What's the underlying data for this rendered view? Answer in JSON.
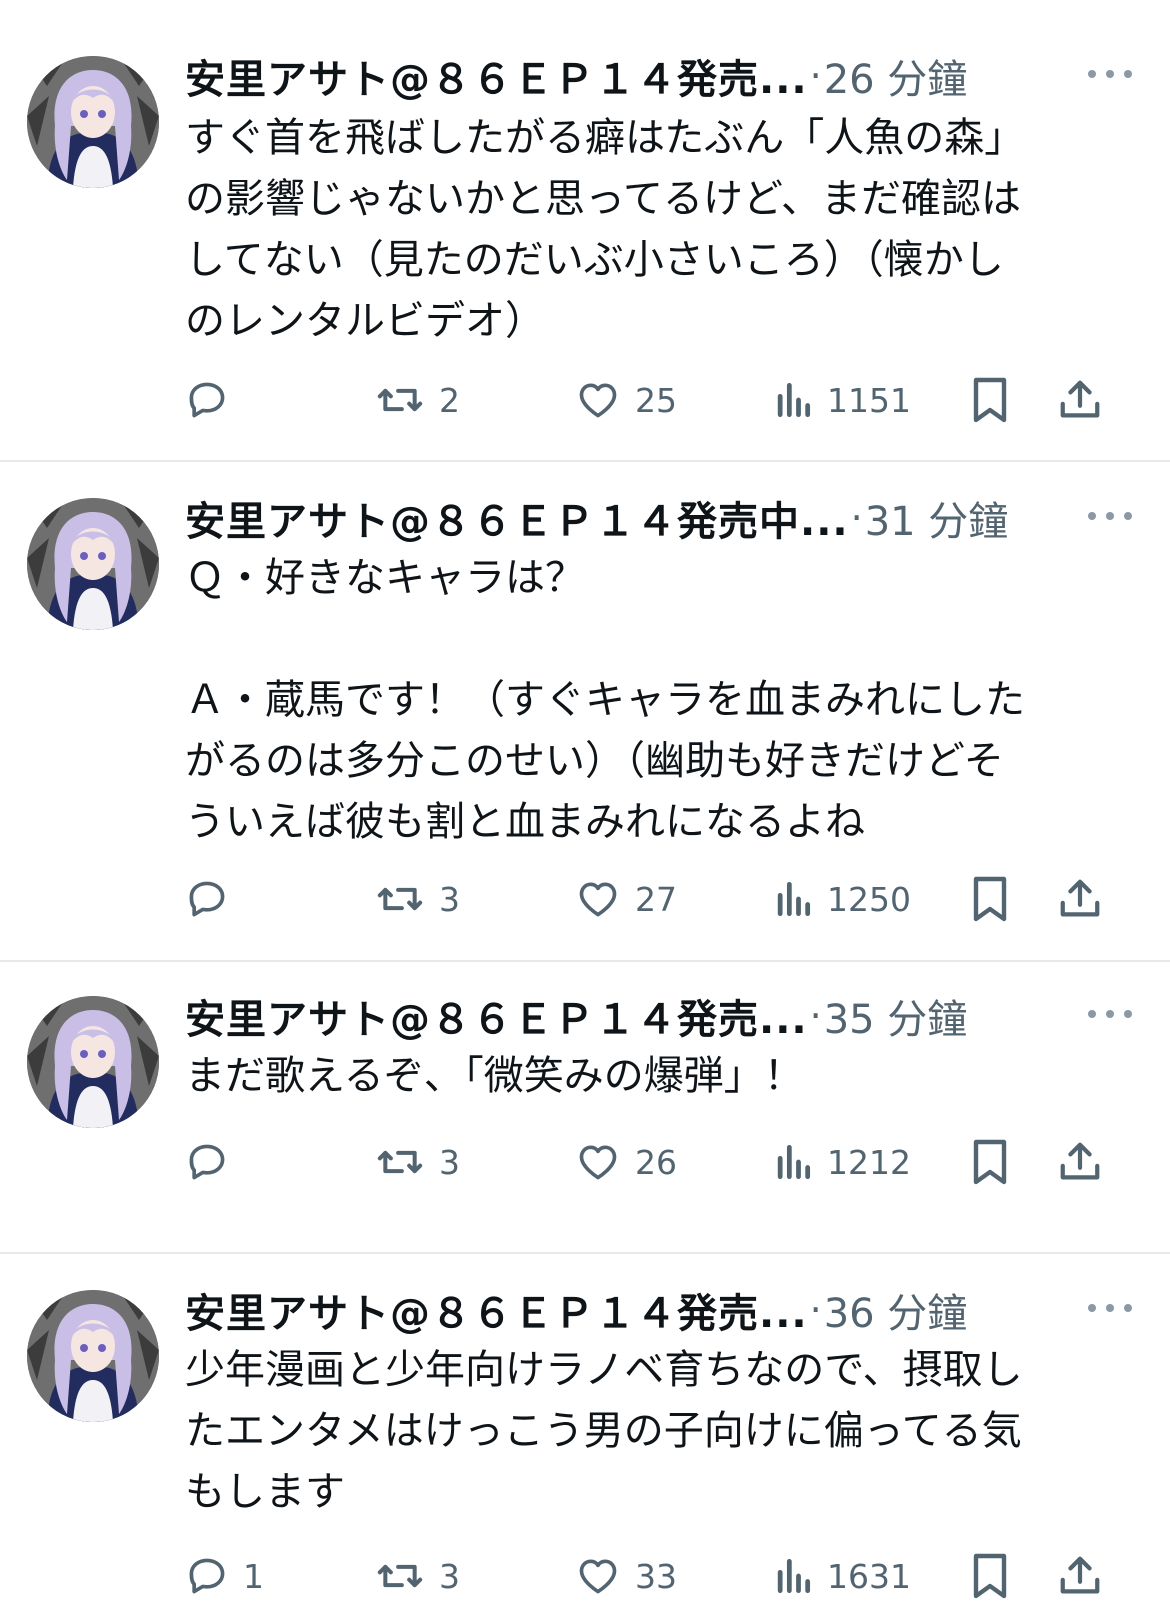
{
  "colors": {
    "text": "#0f1419",
    "muted": "#536471",
    "divider": "#e6e9ec"
  },
  "icons": {
    "reply": "reply-icon",
    "retweet": "retweet-icon",
    "like": "heart-icon",
    "views": "views-icon",
    "bookmark": "bookmark-icon",
    "share": "share-icon",
    "more": "more-icon"
  },
  "tweets": [
    {
      "name": "安里アサト@８６ＥＰ１４発売...",
      "time": "26 分鐘",
      "lines": [
        "すぐ首を飛ばしたがる癖はたぶん「人魚の森」",
        "の影響じゃないかと思ってるけど、まだ確認は",
        "してない（見たのだいぶ小さいころ）（懐かし",
        "のレンタルビデオ）"
      ],
      "replies": "",
      "retweets": "2",
      "likes": "25",
      "views": "1151"
    },
    {
      "name": "安里アサト@８６ＥＰ１４発売中...",
      "time": "31 分鐘",
      "lines": [
        "Ｑ・好きなキャラは？",
        "",
        "Ａ・蔵馬です！（すぐキャラを血まみれにした",
        "がるのは多分このせい）（幽助も好きだけどそ",
        "ういえば彼も割と血まみれになるよね"
      ],
      "replies": "",
      "retweets": "3",
      "likes": "27",
      "views": "1250"
    },
    {
      "name": "安里アサト@８６ＥＰ１４発売...",
      "time": "35 分鐘",
      "lines": [
        "まだ歌えるぞ、「微笑みの爆弾」！"
      ],
      "replies": "",
      "retweets": "3",
      "likes": "26",
      "views": "1212"
    },
    {
      "name": "安里アサト@８６ＥＰ１４発売...",
      "time": "36 分鐘",
      "lines": [
        "少年漫画と少年向けラノベ育ちなので、摂取し",
        "たエンタメはけっこう男の子向けに偏ってる気",
        "もします"
      ],
      "replies": "1",
      "retweets": "3",
      "likes": "33",
      "views": "1631"
    }
  ]
}
